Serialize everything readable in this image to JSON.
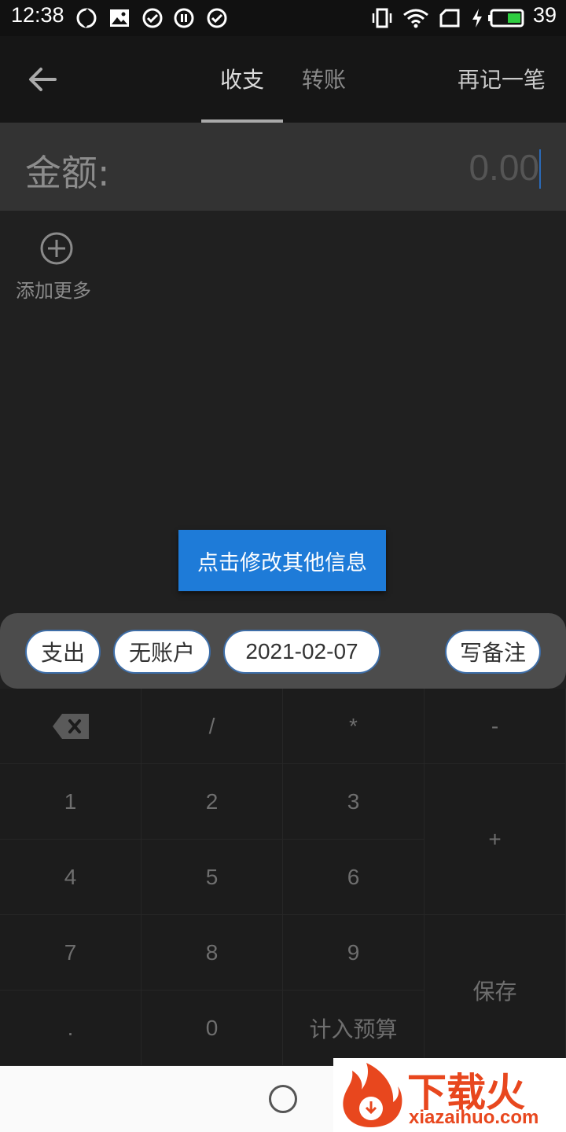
{
  "status_bar": {
    "time": "12:38",
    "battery": "39"
  },
  "header": {
    "tabs": [
      {
        "label": "收支",
        "active": true
      },
      {
        "label": "转账",
        "active": false
      }
    ],
    "again_label": "再记一笔"
  },
  "amount": {
    "label": "金额:",
    "value": "0.00"
  },
  "add_more": {
    "label": "添加更多"
  },
  "hint": {
    "label": "点击修改其他信息"
  },
  "chips": {
    "type": "支出",
    "account": "无账户",
    "date": "2021-02-07",
    "note": "写备注"
  },
  "keypad": {
    "divide": "/",
    "multiply": "*",
    "minus": "-",
    "k1": "1",
    "k2": "2",
    "k3": "3",
    "plus": "+",
    "k4": "4",
    "k5": "5",
    "k6": "6",
    "k7": "7",
    "k8": "8",
    "k9": "9",
    "save": "保存",
    "dot": ".",
    "k0": "0",
    "budget": "计入预算"
  },
  "watermark": {
    "title": "下载火",
    "subtitle": "xiazaihuo.com"
  },
  "colors": {
    "accent": "#1e7bd8",
    "chip_border": "#3e6ea8",
    "watermark": "#e8471e"
  }
}
